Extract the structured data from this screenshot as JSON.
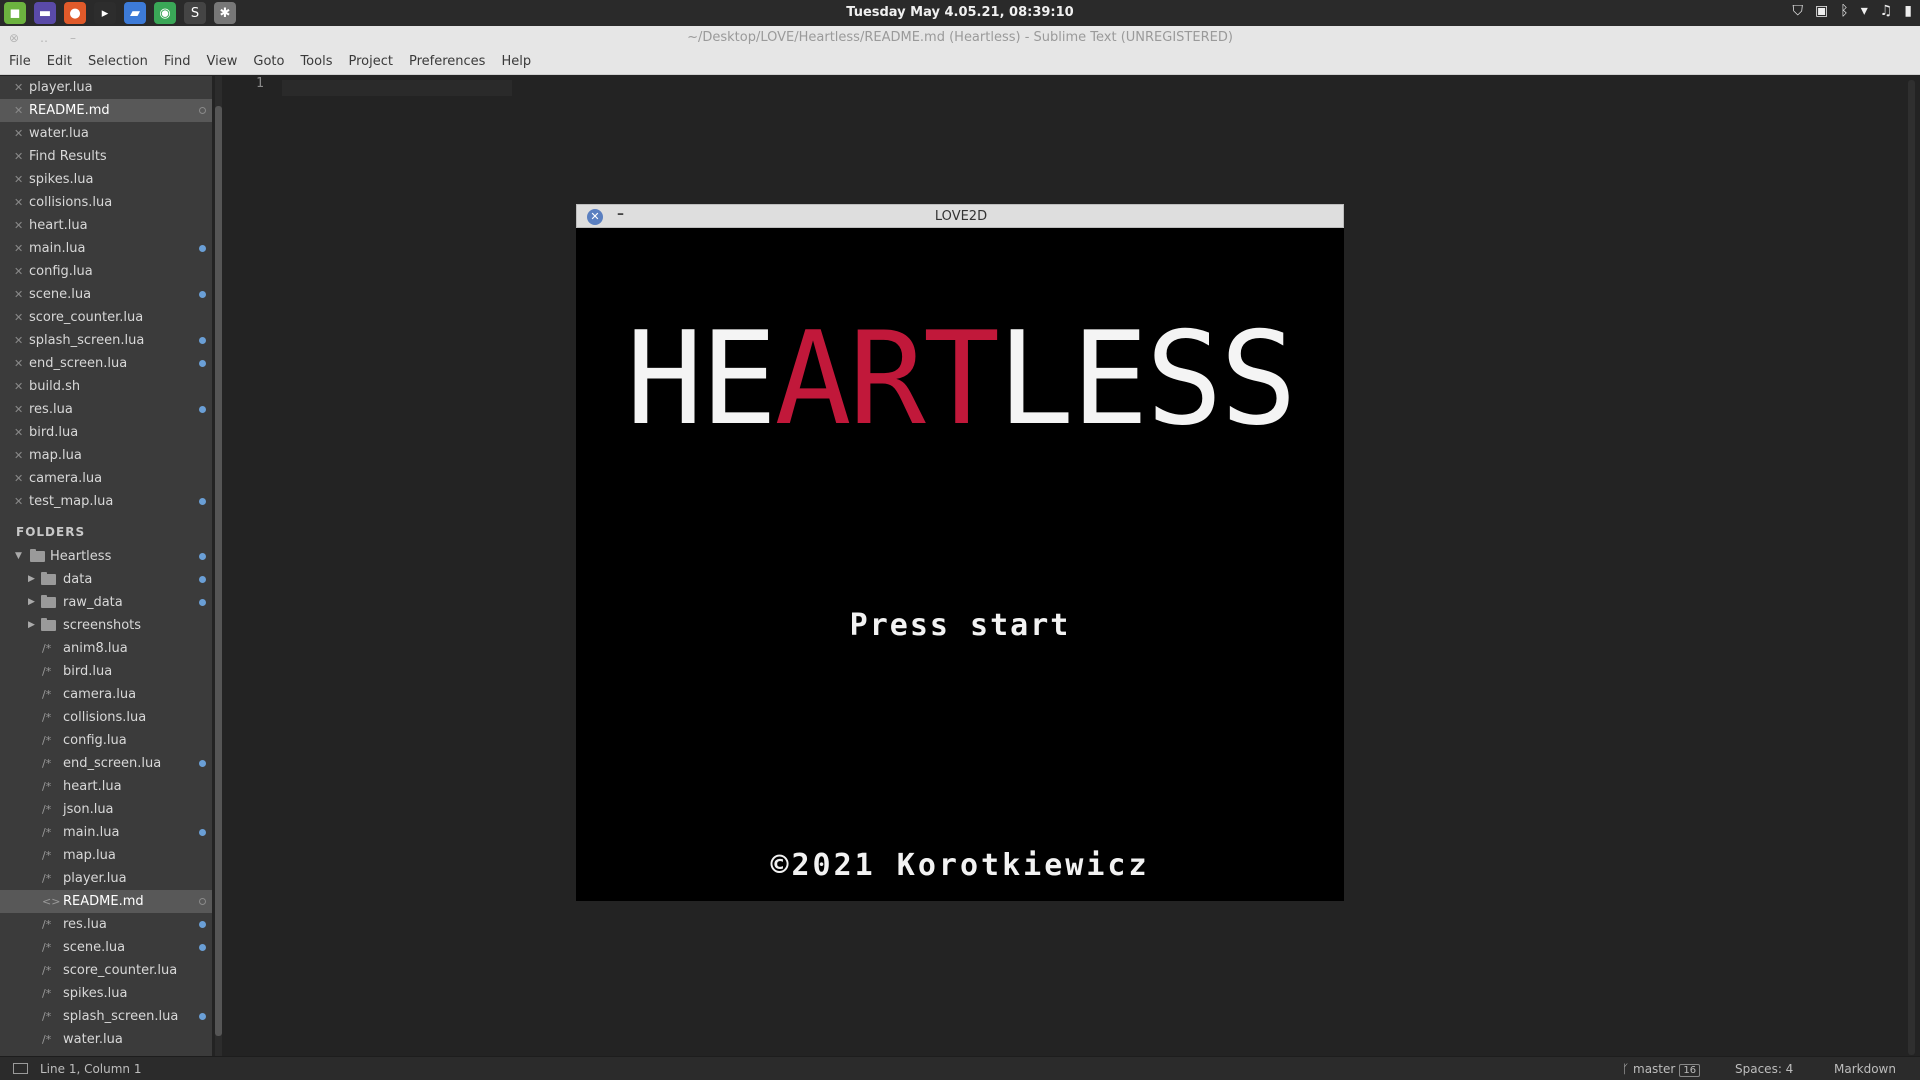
{
  "taskbar": {
    "clock": "Tuesday May  4.05.21, 08:39:10",
    "apps": [
      {
        "name": "menu-icon",
        "glyph": "◼",
        "color": "#6cb33f"
      },
      {
        "name": "workspace-icon",
        "glyph": "▬",
        "color": "#5a4aa8"
      },
      {
        "name": "firefox-icon",
        "glyph": "●",
        "color": "#e05a2a"
      },
      {
        "name": "terminal-icon",
        "glyph": "▸",
        "color": "#2d2d2d"
      },
      {
        "name": "files-icon",
        "glyph": "▰",
        "color": "#3d7bd8"
      },
      {
        "name": "chrome-icon",
        "glyph": "◉",
        "color": "#3aa757"
      },
      {
        "name": "sublime-icon",
        "glyph": "S",
        "color": "#444"
      },
      {
        "name": "settings-icon",
        "glyph": "✱",
        "color": "#777"
      }
    ],
    "tray": [
      "⛉",
      "▣",
      "ᛒ",
      "▾",
      "♫",
      "▮"
    ]
  },
  "window": {
    "title": "~/Desktop/LOVE/Heartless/README.md (Heartless) - Sublime Text (UNREGISTERED)",
    "close_glyph": "⊗",
    "min_glyph": "‥",
    "max_glyph": "–"
  },
  "menu": [
    "File",
    "Edit",
    "Selection",
    "Find",
    "View",
    "Goto",
    "Tools",
    "Project",
    "Preferences",
    "Help"
  ],
  "open_files": [
    {
      "name": "player.lua",
      "dot": ""
    },
    {
      "name": "README.md",
      "dot": "ring",
      "selected": true
    },
    {
      "name": "water.lua",
      "dot": ""
    },
    {
      "name": "Find Results",
      "dot": ""
    },
    {
      "name": "spikes.lua",
      "dot": ""
    },
    {
      "name": "collisions.lua",
      "dot": ""
    },
    {
      "name": "heart.lua",
      "dot": ""
    },
    {
      "name": "main.lua",
      "dot": "blue"
    },
    {
      "name": "config.lua",
      "dot": ""
    },
    {
      "name": "scene.lua",
      "dot": "blue"
    },
    {
      "name": "score_counter.lua",
      "dot": ""
    },
    {
      "name": "splash_screen.lua",
      "dot": "blue"
    },
    {
      "name": "end_screen.lua",
      "dot": "blue"
    },
    {
      "name": "build.sh",
      "dot": ""
    },
    {
      "name": "res.lua",
      "dot": "blue"
    },
    {
      "name": "bird.lua",
      "dot": ""
    },
    {
      "name": "map.lua",
      "dot": ""
    },
    {
      "name": "camera.lua",
      "dot": ""
    },
    {
      "name": "test_map.lua",
      "dot": "blue"
    }
  ],
  "folders_title": "FOLDERS",
  "tree": [
    {
      "name": "Heartless",
      "type": "open-folder",
      "dot": "blue"
    },
    {
      "name": "data",
      "type": "folder",
      "dot": "blue"
    },
    {
      "name": "raw_data",
      "type": "folder",
      "dot": "blue"
    },
    {
      "name": "screenshots",
      "type": "folder",
      "dot": ""
    },
    {
      "name": "anim8.lua",
      "type": "file",
      "dot": ""
    },
    {
      "name": "bird.lua",
      "type": "file",
      "dot": ""
    },
    {
      "name": "camera.lua",
      "type": "file",
      "dot": ""
    },
    {
      "name": "collisions.lua",
      "type": "file",
      "dot": ""
    },
    {
      "name": "config.lua",
      "type": "file",
      "dot": ""
    },
    {
      "name": "end_screen.lua",
      "type": "file",
      "dot": "blue"
    },
    {
      "name": "heart.lua",
      "type": "file",
      "dot": ""
    },
    {
      "name": "json.lua",
      "type": "file",
      "dot": ""
    },
    {
      "name": "main.lua",
      "type": "file",
      "dot": "blue"
    },
    {
      "name": "map.lua",
      "type": "file",
      "dot": ""
    },
    {
      "name": "player.lua",
      "type": "file",
      "dot": ""
    },
    {
      "name": "README.md",
      "type": "md",
      "dot": "ring",
      "selected": true
    },
    {
      "name": "res.lua",
      "type": "file",
      "dot": "blue"
    },
    {
      "name": "scene.lua",
      "type": "file",
      "dot": "blue"
    },
    {
      "name": "score_counter.lua",
      "type": "file",
      "dot": ""
    },
    {
      "name": "spikes.lua",
      "type": "file",
      "dot": ""
    },
    {
      "name": "splash_screen.lua",
      "type": "file",
      "dot": "blue"
    },
    {
      "name": "water.lua",
      "type": "file",
      "dot": ""
    }
  ],
  "editor": {
    "line_number": "1"
  },
  "game": {
    "title": "LOVE2D",
    "close_glyph": "✕",
    "min_glyph": "–",
    "logo_letters": [
      {
        "ch": "H",
        "red": false
      },
      {
        "ch": "E",
        "red": false
      },
      {
        "ch": "A",
        "red": true
      },
      {
        "ch": "R",
        "red": true
      },
      {
        "ch": "T",
        "red": true
      },
      {
        "ch": "L",
        "red": false
      },
      {
        "ch": "E",
        "red": false
      },
      {
        "ch": "S",
        "red": false
      },
      {
        "ch": "S",
        "red": false
      }
    ],
    "press": "Press start",
    "copyright": "©2021 Korotkiewicz"
  },
  "status": {
    "position": "Line 1, Column 1",
    "branch": "master",
    "branch_count": "16",
    "spaces": "Spaces: 4",
    "syntax": "Markdown"
  },
  "colors": {
    "accent_dot": "#6a9fd6",
    "logo_red": "#c1183a"
  }
}
